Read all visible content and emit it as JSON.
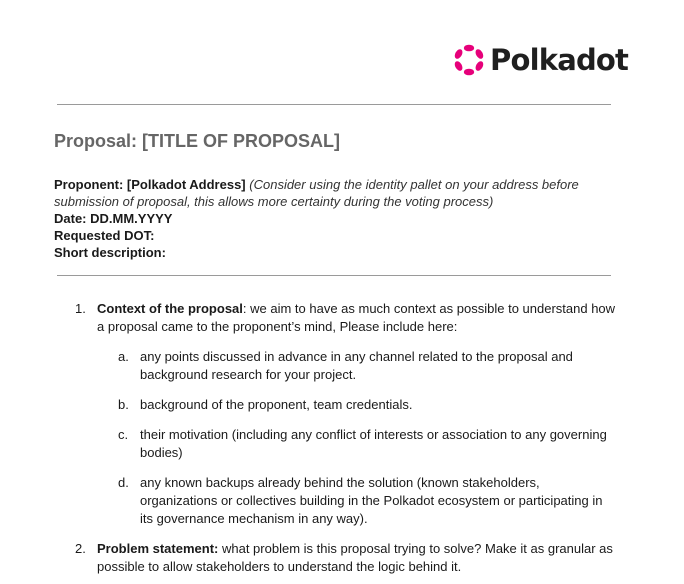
{
  "logo": {
    "text": "Polkadot",
    "icon": "polkadot-ring-icon",
    "accent_color": "#e6007a"
  },
  "title": "Proposal: [TITLE OF PROPOSAL]",
  "meta": {
    "proponent_label": "Proponent: [Polkadot Address]",
    "proponent_note": "(Consider using the identity pallet on your address before submission of proposal, this allows more certainty during the voting process)",
    "date_label": "Date: DD.MM.YYYY",
    "requested_label": "Requested DOT:",
    "short_desc_label": "Short description:"
  },
  "items": [
    {
      "num": "1.",
      "heading": "Context of the proposal",
      "text": ": we aim to have as much context as possible to understand how a proposal came to the proponent’s mind, Please include here:",
      "subitems": [
        {
          "letter": "a.",
          "text": " any points discussed in advance in any channel related to the proposal and background research for your project."
        },
        {
          "letter": "b.",
          "text": "background of the proponent, team credentials."
        },
        {
          "letter": "c.",
          "text": "their motivation (including any conflict of interests or association to any governing bodies)"
        },
        {
          "letter": "d.",
          "text": "any known backups already behind the solution (known stakeholders, organizations or collectives building in the Polkadot ecosystem or participating in its governance mechanism in any way)."
        }
      ]
    },
    {
      "num": "2.",
      "heading": "Problem statement:",
      "text": " what problem is this proposal trying to solve? Make it as granular as possible to allow stakeholders to understand the logic behind it."
    }
  ]
}
